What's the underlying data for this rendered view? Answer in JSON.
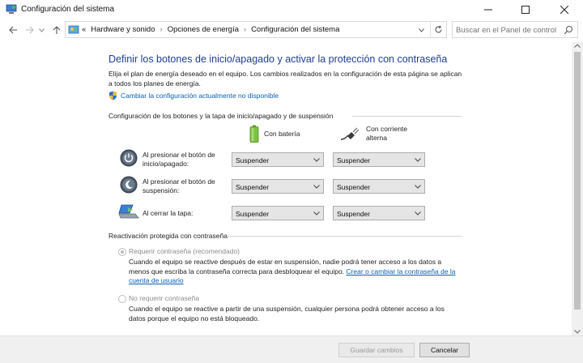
{
  "window": {
    "title": "Configuración del sistema"
  },
  "address": {
    "breadcrumbs": [
      "Hardware y sonido",
      "Opciones de energía",
      "Configuración del sistema"
    ],
    "search_placeholder": "Buscar en el Panel de control",
    "overflow": "«",
    "separator": "›"
  },
  "page": {
    "heading": "Definir los botones de inicio/apagado y activar la protección con contraseña",
    "intro": "Elija el plan de energía deseado en el equipo. Los cambios realizados en la configuración de esta página se aplican a todos los planes de energía.",
    "change_settings_link": "Cambiar la configuración actualmente no disponible"
  },
  "buttons_section": {
    "title": "Configuración de los botones y la tapa de inicio/apagado y de suspensión",
    "columns": {
      "battery": "Con batería",
      "ac": "Con corriente alterna"
    },
    "rows": [
      {
        "label": "Al presionar el botón de inicio/apagado:",
        "battery": "Suspender",
        "ac": "Suspender"
      },
      {
        "label": "Al presionar el botón de suspensión:",
        "battery": "Suspender",
        "ac": "Suspender"
      },
      {
        "label": "Al cerrar la tapa:",
        "battery": "Suspender",
        "ac": "Suspender"
      }
    ]
  },
  "password_section": {
    "title": "Reactivación protegida con contraseña",
    "require": {
      "label": "Requerir contraseña (recomendado)",
      "description": "Cuando el equipo se reactive después de estar en suspensión, nadie podrá tener acceso a los datos a menos que escriba la contraseña correcta para desbloquear el equipo.",
      "link": "Crear o cambiar la contraseña de la cuenta de usuario"
    },
    "no_require": {
      "label": "No requerir contraseña",
      "description": "Cuando el equipo se reactive a partir de una suspensión, cualquier persona podrá obtener acceso a los datos porque el equipo no está bloqueado."
    }
  },
  "footer": {
    "save": "Guardar cambios",
    "cancel": "Cancelar"
  }
}
